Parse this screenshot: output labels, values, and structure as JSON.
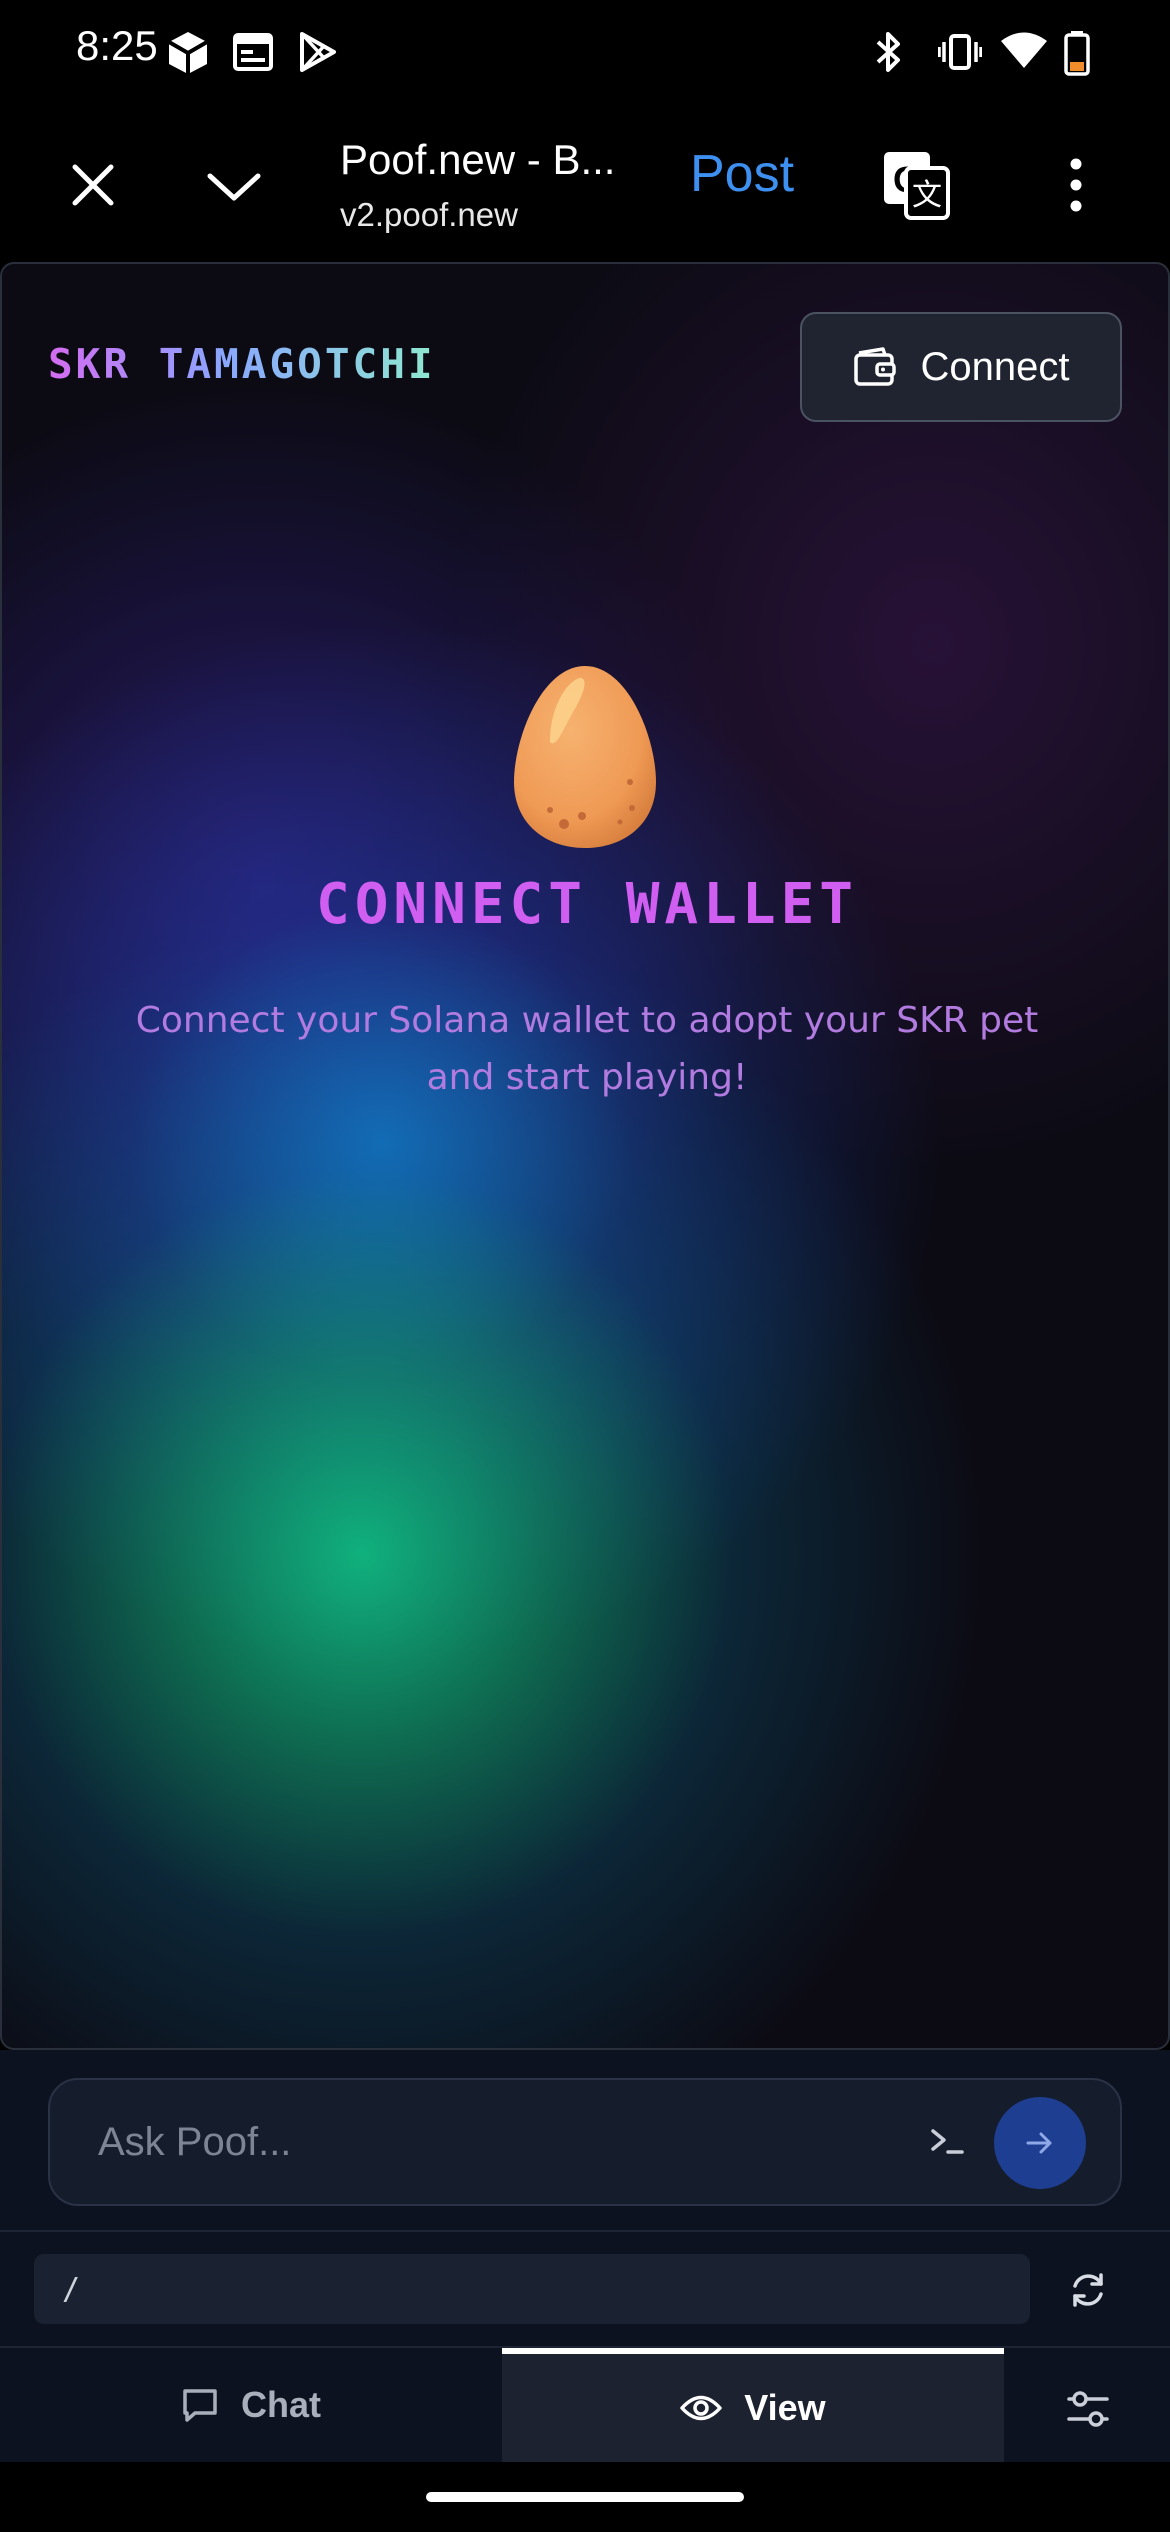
{
  "status_bar": {
    "time": "8:25",
    "left_icons": [
      "hexagon-app-icon",
      "calendar-icon",
      "play-store-icon"
    ],
    "right_icons": [
      "bluetooth-icon",
      "vibrate-icon",
      "wifi-icon",
      "battery-icon"
    ]
  },
  "browser": {
    "title": "Poof.new - B...",
    "url": "v2.poof.new",
    "post_label": "Post",
    "icons": [
      "close-icon",
      "chevron-down-icon",
      "translate-icon",
      "more-vert-icon"
    ]
  },
  "app": {
    "title": "SKR TAMAGOTCHI",
    "connect_button": "Connect",
    "heading": "CONNECT WALLET",
    "description": "Connect your Solana wallet to adopt your SKR pet and start playing!",
    "colors": {
      "title_gradient": [
        "#d46cf0",
        "#8aa6ff",
        "#8ee8d0"
      ],
      "heading": "#d05ef0",
      "description": "#b27be0",
      "egg": "#f0a060"
    }
  },
  "bottom": {
    "ask_placeholder": "Ask Poof...",
    "path_value": "/",
    "tabs": [
      {
        "label": "Chat",
        "icon": "chat-bubble-icon",
        "active": false
      },
      {
        "label": "View",
        "icon": "eye-icon",
        "active": true
      }
    ]
  }
}
